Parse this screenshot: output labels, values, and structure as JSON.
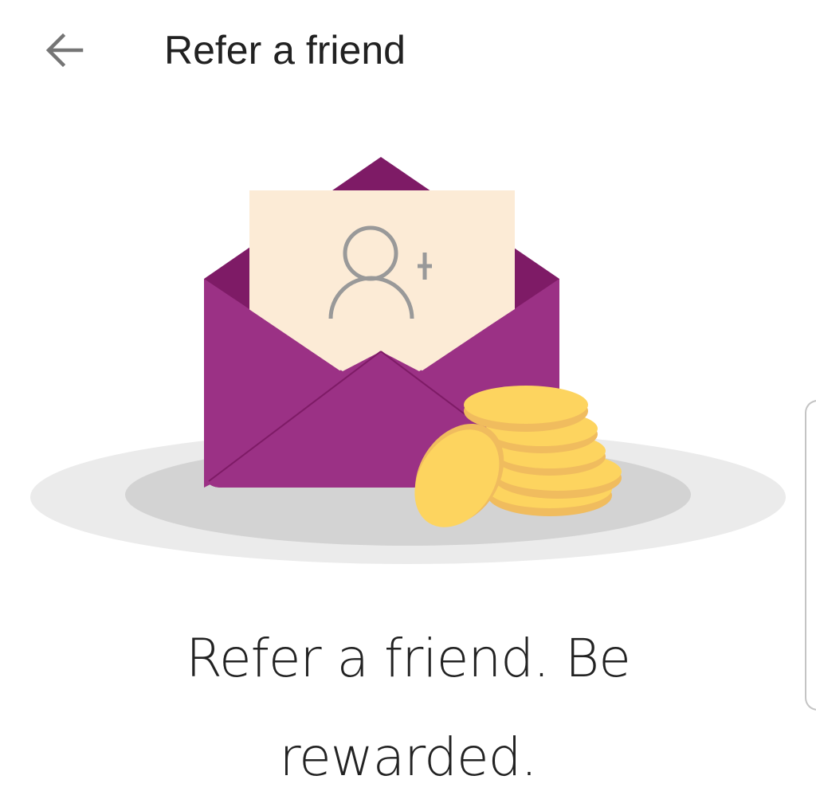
{
  "header": {
    "back_icon": "arrow-left-icon",
    "title": "Refer a friend"
  },
  "illustration": {
    "description": "Open purple envelope with letter showing add-user icon and stack of gold coins",
    "letter_icon": "add-user-icon",
    "colors": {
      "envelope": "#9b3185",
      "envelope_dark": "#7e1b66",
      "letter": "#fcebd6",
      "user_icon": "#999999",
      "coin": "#fdd45f",
      "coin_edge": "#f0bc5e",
      "plate_outer": "#ebebeb",
      "plate_inner": "#d3d3d3"
    }
  },
  "headline": {
    "line1": "Refer a friend. Be",
    "line2": "rewarded."
  },
  "edge_panel": {
    "icon": "edge-panel-handle"
  }
}
